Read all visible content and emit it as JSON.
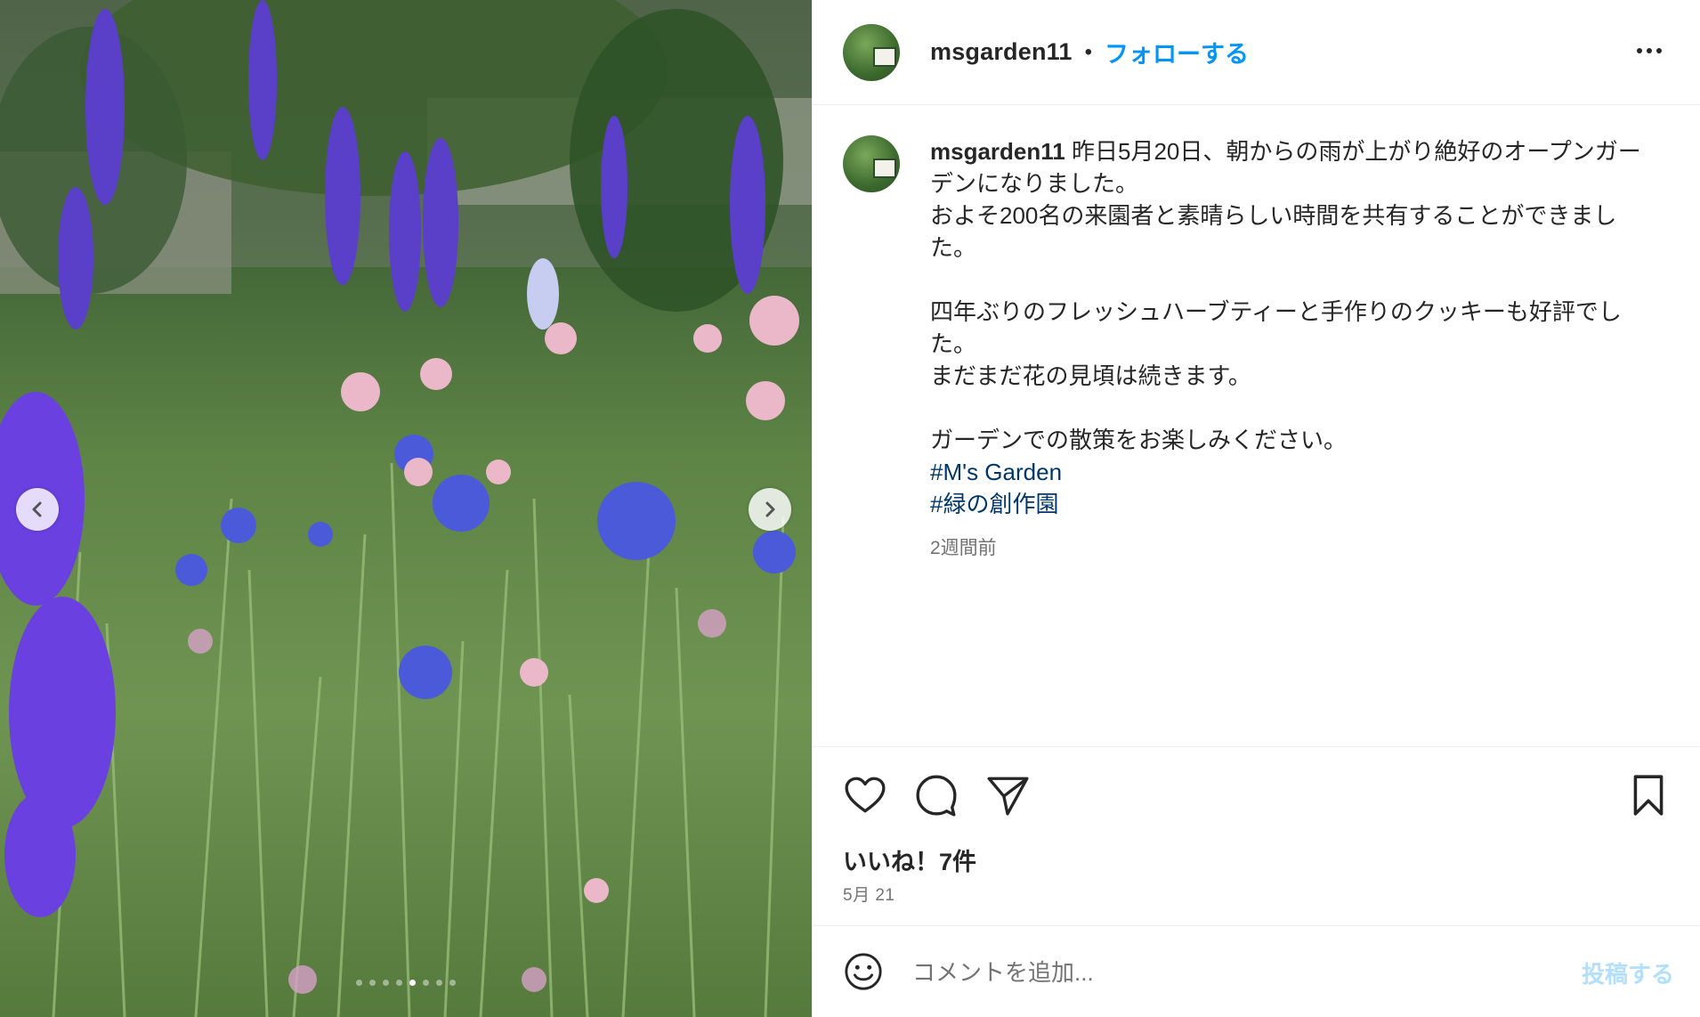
{
  "post": {
    "username": "msgarden11",
    "separator": "•",
    "follow_label": "フォローする",
    "more_icon": "more-horizontal-icon",
    "caption_text": "昨日5月20日、朝からの雨が上がり絶好のオープンガーデンになりました。\nおよそ200名の来園者と素晴らしい時間を共有することができました。\n\n四年ぶりのフレッシュハーブティーと手作りのクッキーも好評でした。\nまだまだ花の見頃は続きます。\n\nガーデンでの散策をお楽しみください。",
    "hashtags": [
      "#M's Garden",
      "#緑の創作園"
    ],
    "caption_time": "2週間前",
    "likes": "いいね！7件",
    "date": "5月 21"
  },
  "media": {
    "prev_icon": "chevron-left-icon",
    "next_icon": "chevron-right-icon",
    "carousel": {
      "count": 8,
      "active_index": 4
    }
  },
  "actions": {
    "like_icon": "heart-icon",
    "comment_icon": "comment-icon",
    "share_icon": "send-icon",
    "save_icon": "bookmark-icon"
  },
  "comment": {
    "emoji_icon": "smiley-icon",
    "placeholder": "コメントを追加...",
    "post_label": "投稿する"
  },
  "colors": {
    "accent": "#0095f6",
    "hashtag": "#00376b",
    "muted": "#737373",
    "post_disabled": "#b2dffc"
  }
}
